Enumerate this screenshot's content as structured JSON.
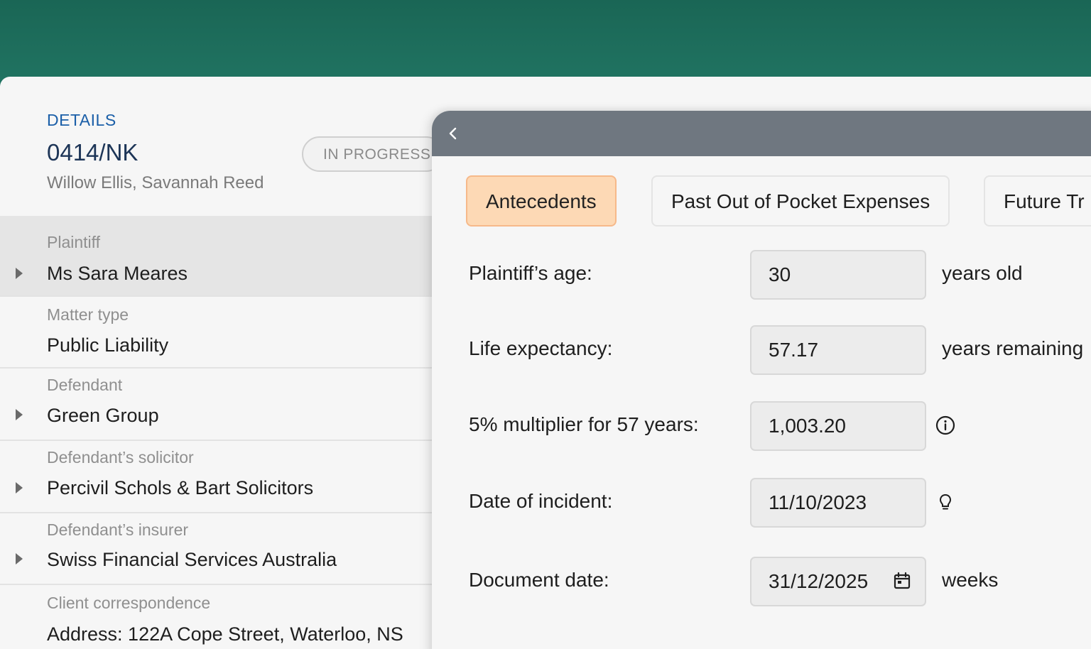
{
  "details": {
    "section_label": "DETAILS",
    "case_id": "0414/NK",
    "case_names": "Willow Ellis, Savannah Reed",
    "status": "IN PROGRESS"
  },
  "rows": [
    {
      "label": "Plaintiff",
      "value": "Ms Sara Meares"
    },
    {
      "label": "Matter type",
      "value": "Public Liability"
    },
    {
      "label": "Defendant",
      "value": "Green Group"
    },
    {
      "label": "Defendant’s solicitor",
      "value": "Percivil Schols & Bart Solicitors"
    },
    {
      "label": "Defendant’s insurer",
      "value": "Swiss Financial Services Australia"
    },
    {
      "label": "Client correspondence",
      "value": "Address: 122A Cope Street, Waterloo, NS"
    }
  ],
  "calc": {
    "tabs": [
      {
        "label": "Antecedents"
      },
      {
        "label": "Past Out of Pocket Expenses"
      },
      {
        "label": "Future Tr"
      }
    ],
    "fields": [
      {
        "label": "Plaintiff’s age:",
        "value": "30",
        "suffix": "years old"
      },
      {
        "label": "Life expectancy:",
        "value": "57.17",
        "suffix": "years remaining"
      },
      {
        "label": "5% multiplier for 57 years:",
        "value": "1,003.20",
        "suffix": ""
      },
      {
        "label": "Date of incident:",
        "value": "11/10/2023",
        "suffix": ""
      },
      {
        "label": "Document date:",
        "value": "31/12/2025",
        "suffix": "weeks"
      }
    ]
  },
  "icons": {
    "back": "chevron-left-icon",
    "info": "info-icon",
    "hint": "lightbulb-icon",
    "calendar": "calendar-icon",
    "caret": "caret-right-icon"
  },
  "colors": {
    "brand_green": "#1f6e5c",
    "accent_blue": "#1b5fa8",
    "header_gray": "#6f7780",
    "active_tab": "#fdd9b5"
  }
}
